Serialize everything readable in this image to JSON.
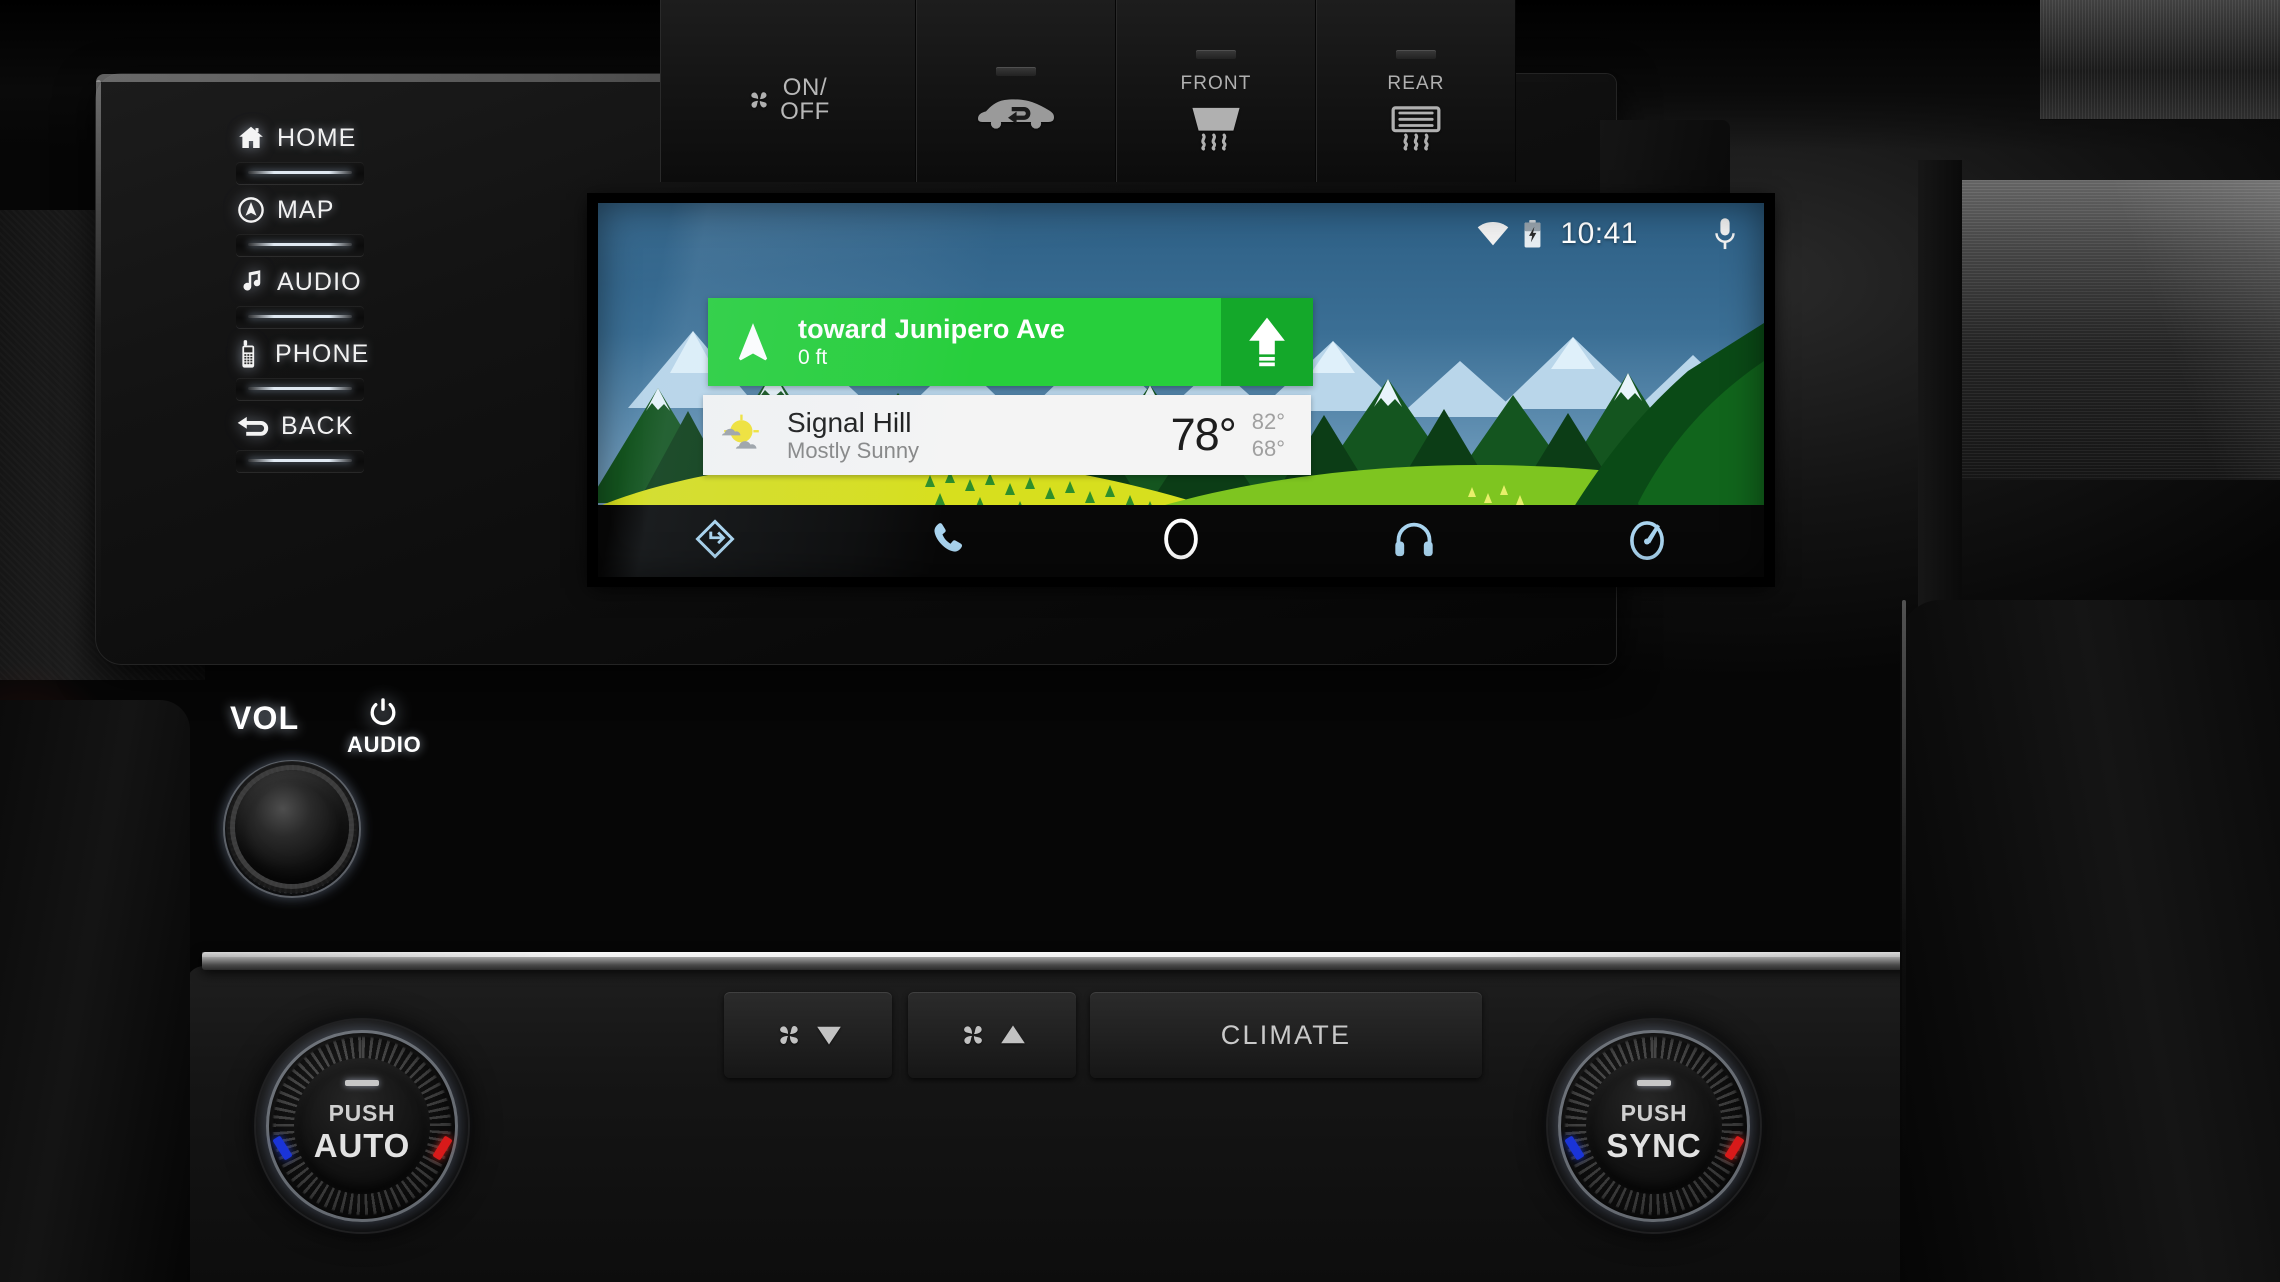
{
  "screen": {
    "status_bar": {
      "wifi_icon": "wifi-icon",
      "battery_icon": "battery-charging-icon",
      "clock": "10:41",
      "mic_icon": "microphone-icon"
    },
    "navigation_card": {
      "maneuver_icon_left": "navigation-arrow-icon",
      "street": "toward Junipero Ave",
      "distance": "0 ft",
      "maneuver_icon_right": "straight-ahead-arrow-icon",
      "color": "#27cf3c",
      "maneuver_color": "#14a82a"
    },
    "weather_card": {
      "icon": "partly-cloudy-icon",
      "city": "Signal Hill",
      "condition": "Mostly Sunny",
      "temp": "78°",
      "high": "82°",
      "low": "68°"
    },
    "nav_bar": {
      "items": [
        {
          "icon": "navigation-maps-icon",
          "name": "navigation"
        },
        {
          "icon": "phone-icon",
          "name": "phone"
        },
        {
          "icon": "home-circle-icon",
          "name": "home"
        },
        {
          "icon": "headphones-media-icon",
          "name": "media"
        },
        {
          "icon": "car-gauge-icon",
          "name": "oem-apps"
        }
      ],
      "accent": "#a9d4ef"
    }
  },
  "hardware_buttons": {
    "left_side": [
      {
        "label": "HOME",
        "icon": "house-icon"
      },
      {
        "label": "MAP",
        "icon": "map-compass-icon"
      },
      {
        "label": "AUDIO",
        "icon": "music-note-icon"
      },
      {
        "label": "PHONE",
        "icon": "cellphone-icon"
      },
      {
        "label": "BACK",
        "icon": "back-arrow-icon"
      }
    ],
    "volume": {
      "label": "VOL",
      "audio_label": "AUDIO",
      "power_icon": "power-icon"
    }
  },
  "climate": {
    "fan_down": {
      "label": "",
      "icon": "fan-icon",
      "arrow": "down-triangle-icon"
    },
    "fan_up": {
      "label": "",
      "icon": "fan-icon",
      "arrow": "up-triangle-icon"
    },
    "climate_button": {
      "label": "CLIMATE"
    },
    "bottom_row": [
      {
        "label_line1": "ON/",
        "label_line2": "OFF",
        "icon": "fan-icon",
        "name": "fan-on-off"
      },
      {
        "label_line1": "",
        "label_line2": "",
        "icon": "recirculation-car-icon",
        "name": "air-recirculation"
      },
      {
        "label_line1": "FRONT",
        "label_line2": "",
        "icon": "front-defroster-icon",
        "name": "front-defroster"
      },
      {
        "label_line1": "REAR",
        "label_line2": "",
        "icon": "rear-defroster-icon",
        "name": "rear-defroster"
      }
    ],
    "left_knob": {
      "push": "PUSH",
      "mode": "AUTO",
      "cold_color": "#1a34d8",
      "hot_color": "#d81a1a"
    },
    "right_knob": {
      "push": "PUSH",
      "mode": "SYNC",
      "cold_color": "#1a34d8",
      "hot_color": "#d81a1a"
    }
  }
}
